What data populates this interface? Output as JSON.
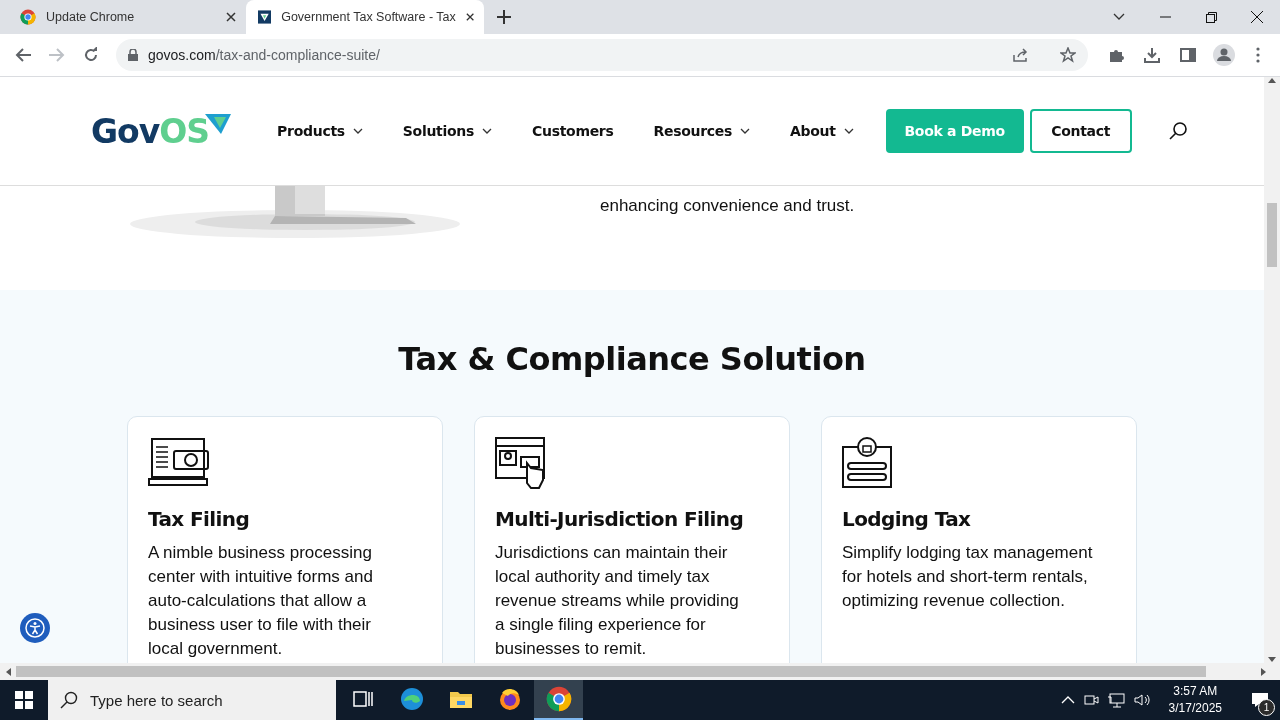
{
  "browser": {
    "tabs": [
      {
        "title": "Update Chrome",
        "selected": false,
        "kind": "chrome"
      },
      {
        "title": "Government Tax Software - Tax",
        "selected": true,
        "kind": "site"
      }
    ],
    "address": {
      "domain": "govos.com",
      "path": "/tax-and-compliance-suite/"
    }
  },
  "site": {
    "logo": {
      "primary": "Gov",
      "accent": "OS"
    },
    "nav": [
      {
        "label": "Products",
        "dropdown": true
      },
      {
        "label": "Solutions",
        "dropdown": true
      },
      {
        "label": "Customers",
        "dropdown": false
      },
      {
        "label": "Resources",
        "dropdown": true
      },
      {
        "label": "About",
        "dropdown": true
      }
    ],
    "buttons": [
      {
        "label": "Book a Demo",
        "kind": "primary"
      },
      {
        "label": "Contact",
        "kind": "outline"
      }
    ],
    "intro_text": "enhancing convenience and trust.",
    "section_title": "Tax & Compliance Solution",
    "cards": [
      {
        "kind": "laptop",
        "title": "Tax Filing",
        "body": "A nimble business processing center with intuitive forms and auto-calculations that allow a business user to file with their local government."
      },
      {
        "kind": "browser",
        "title": "Multi-Jurisdiction Filing",
        "body": "Jurisdictions can maintain their local authority and timely tax revenue streams while providing a single filing experience for businesses to remit."
      },
      {
        "kind": "lock",
        "title": "Lodging Tax",
        "body": "Simplify lodging tax management for hotels and short-term rentals, optimizing revenue collection."
      }
    ]
  },
  "taskbar": {
    "search_placeholder": "Type here to search",
    "apps": [
      {
        "kind": "taskview",
        "selected": false
      },
      {
        "kind": "edge",
        "selected": false
      },
      {
        "kind": "folder",
        "selected": false
      },
      {
        "kind": "firefox",
        "selected": false
      },
      {
        "kind": "chrome",
        "selected": true
      }
    ],
    "time": "3:57 AM",
    "date": "3/17/2025",
    "notifications": "1"
  }
}
